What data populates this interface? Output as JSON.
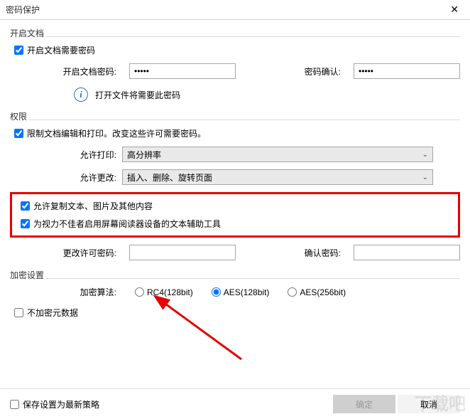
{
  "window": {
    "title": "密码保护",
    "close": "✕"
  },
  "open_doc": {
    "group_label": "开启文档",
    "require_pw_label": "开启文档需要密码",
    "require_pw_checked": true,
    "pw_label": "开启文档密码:",
    "pw_value": "•••••",
    "confirm_label": "密码确认:",
    "confirm_value": "•••••",
    "info_text": "打开文件将需要此密码"
  },
  "permissions": {
    "group_label": "权限",
    "restrict_label": "限制文档编辑和打印。改变这些许可需要密码。",
    "restrict_checked": true,
    "print_label": "允许打印:",
    "print_value": "高分辨率",
    "change_label": "允许更改:",
    "change_value": "插入、删除、旋转页面",
    "allow_copy_label": "允许复制文本、图片及其他内容",
    "allow_copy_checked": true,
    "allow_screen_reader_label": "为视力不佳者启用屏幕阅读器设备的文本辅助工具",
    "allow_screen_reader_checked": true,
    "perm_pw_label": "更改许可密码:",
    "perm_pw_value": "",
    "perm_confirm_label": "确认密码:",
    "perm_confirm_value": ""
  },
  "encryption": {
    "group_label": "加密设置",
    "algo_label": "加密算法:",
    "options": [
      {
        "label": "RC4(128bit)",
        "checked": false
      },
      {
        "label": "AES(128bit)",
        "checked": true
      },
      {
        "label": "AES(256bit)",
        "checked": false
      }
    ],
    "no_meta_label": "不加密元数据",
    "no_meta_checked": false
  },
  "footer": {
    "save_policy_label": "保存设置为最新策略",
    "save_policy_checked": false,
    "ok": "确定",
    "cancel": "取消"
  },
  "watermark": "下载吧"
}
